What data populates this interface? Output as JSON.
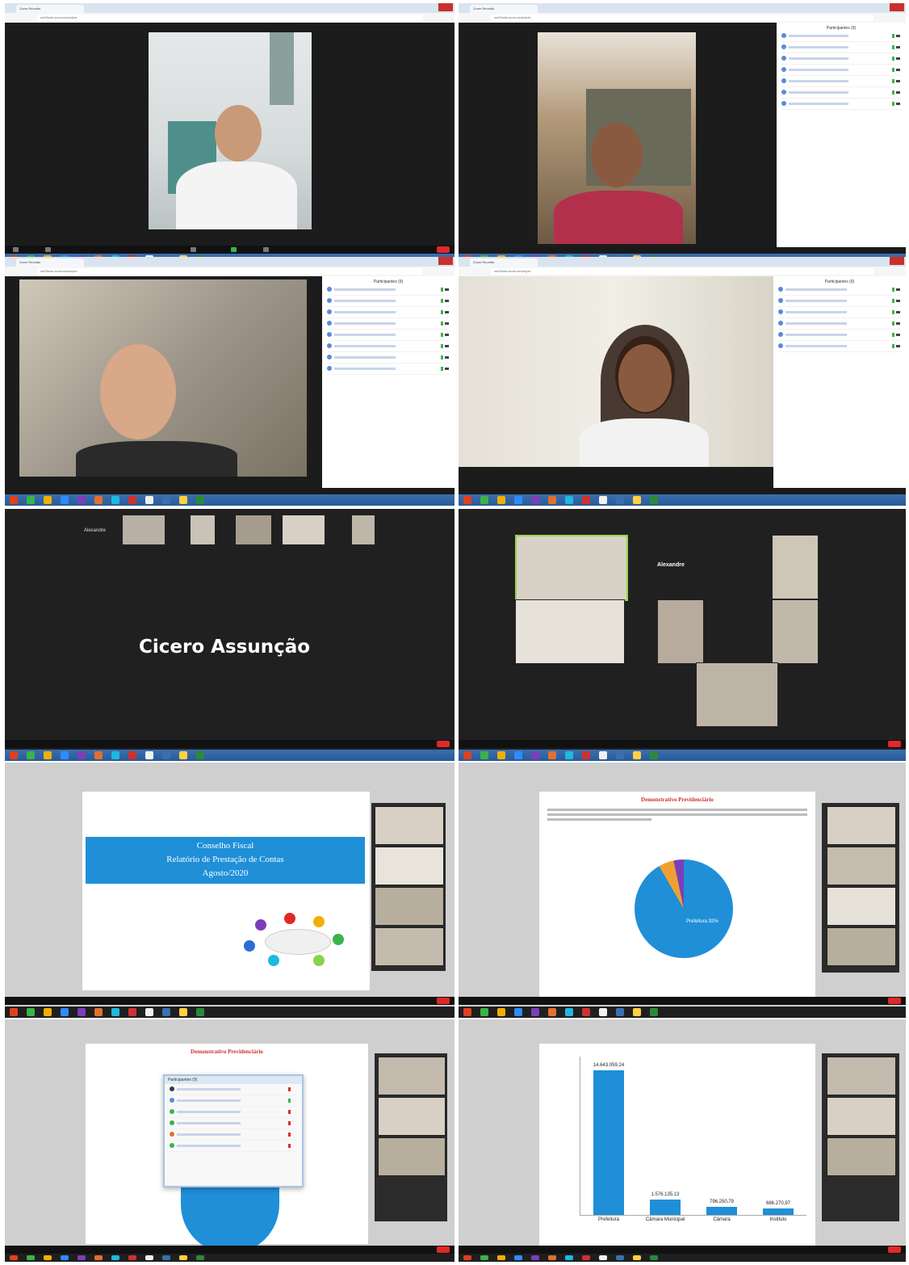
{
  "panels": {
    "p1": {
      "tab": "Zoom Reunião",
      "url": "us02web.zoom.us/wc/join"
    },
    "p2": {
      "tab": "Zoom Reunião",
      "url": "us02web.zoom.us/wc/join",
      "participants_title": "Participantes (9)"
    },
    "p3": {
      "tab": "Zoom Reunião",
      "url": "us02web.zoom.us/wc/join",
      "participants_title": "Participantes (9)"
    },
    "p4": {
      "tab": "Zoom Reunião",
      "url": "us02web.zoom.us/wc/join",
      "participants_title": "Participantes (9)"
    },
    "p5": {
      "speaker_name": "Cicero Assunção",
      "top_name": "Alexandre"
    },
    "p6": {
      "center_name": "Alexandre"
    },
    "p7": {
      "slide_title_line1": "Conselho Fiscal",
      "slide_title_line2": "Relatório de Prestação de Contas",
      "slide_title_line3": "Agosto/2020"
    },
    "p8": {
      "slide_heading": "Demonstrativo Previdenciário",
      "pie_label_main": "Prefeitura 92%"
    },
    "p9": {
      "slide_heading": "Demonstrativo Previdenciário",
      "dialog_title": "Participantes (9)"
    },
    "p10": {
      "chart_data": {
        "type": "bar",
        "categories": [
          "Prefeitura",
          "Câmara Municipal",
          "Câmara",
          "Instituto"
        ],
        "values": [
          14643059.24,
          1576135.13,
          796250.79,
          686270.97
        ],
        "data_labels": [
          "14.643.059,24",
          "1.576.135,13",
          "796.250,79",
          "686.270,97"
        ],
        "ylim": [
          0,
          16000000
        ]
      }
    }
  },
  "colors": {
    "zoom_blue": "#2d8cff",
    "end_red": "#e02828",
    "slide_blue": "#1f8fd8",
    "taskbar": "#2a5a96"
  }
}
